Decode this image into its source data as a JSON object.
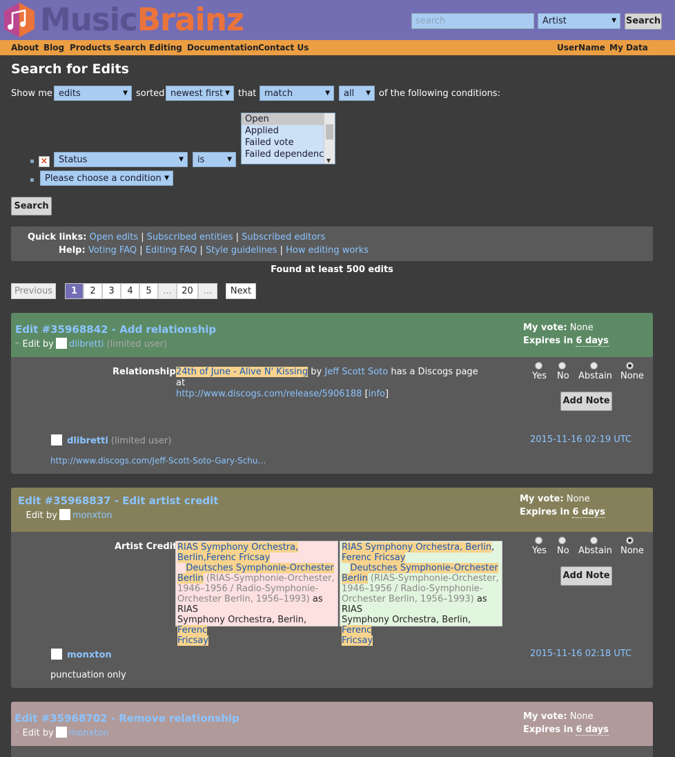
{
  "header": {
    "logo_text_1": "Music",
    "logo_text_2": "Brainz",
    "search_placeholder": "search",
    "search_type": "Artist",
    "search_button": "Search"
  },
  "nav": {
    "left": [
      "About",
      "Blog",
      "Products",
      "Search",
      "Editing",
      "Documentation",
      "Contact Us"
    ],
    "right": [
      "UserName",
      "My Data"
    ]
  },
  "form": {
    "title": "Search for Edits",
    "show_me_label": "Show me",
    "show_me_value": "edits",
    "sorted_label": "sorted",
    "sorted_value": "newest first",
    "that_label": "that",
    "match_value": "match",
    "all_value": "all",
    "conditions_label": "of the following conditions:",
    "condition_field": "Status",
    "condition_op": "is",
    "status_options": [
      "Open",
      "Applied",
      "Failed vote",
      "Failed dependency"
    ],
    "new_condition": "Please choose a condition",
    "search_button": "Search"
  },
  "quicklinks": {
    "label": "Quick links:",
    "links": [
      "Open edits",
      "Subscribed entities",
      "Subscribed editors"
    ],
    "help_label": "Help:",
    "help_links": [
      "Voting FAQ",
      "Editing FAQ",
      "Style guidelines",
      "How editing works"
    ]
  },
  "found": "Found at least 500 edits",
  "pagination": {
    "previous": "Previous",
    "pages": [
      "1",
      "2",
      "3",
      "4",
      "5",
      "…",
      "20",
      "…"
    ],
    "current": "1",
    "next": "Next"
  },
  "vote_options": [
    "Yes",
    "No",
    "Abstain",
    "None"
  ],
  "edits": [
    {
      "title": "Edit #35968842 - Add relationship",
      "edit_by": "Edit by",
      "editor": "dlibretti",
      "editor_note": "(limited user)",
      "my_vote_label": "My vote:",
      "my_vote": "None",
      "expires_label": "Expires in",
      "expires": "6 days",
      "field_label": "Relationship:",
      "rel_release": "24th of June - Alive N' Kissing",
      "rel_by": "by",
      "rel_artist": "Jeff Scott Soto",
      "rel_text": "has a Discogs page at",
      "rel_url": "http://www.discogs.com/release/5906188",
      "rel_info": "info",
      "add_note": "Add Note",
      "note_editor": "dlibretti",
      "note_editor_note": "(limited user)",
      "note_date": "2015-11-16 02:19 UTC",
      "note_text": "http://www.discogs.com/Jeff-Scott-Soto-Gary-Schu…"
    },
    {
      "title": "Edit #35968837 - Edit artist credit",
      "edit_by": "Edit by",
      "editor": "monxton",
      "my_vote_label": "My vote:",
      "my_vote": "None",
      "expires_label": "Expires in",
      "expires": "6 days",
      "field_label": "Artist Credit:",
      "old_l1": "RIAS Symphony Orchestra,",
      "old_l2": "Berlin,Ferenc Fricsay",
      "old_l3": "Deutsches Symphonie-Orchester",
      "old_l4": "Berlin",
      "old_l4b": "(RIAS-Symphonie-Orchester,",
      "old_l5": "1946–1956 / Radio-Symphonie-",
      "old_l6": "Orchester Berlin, 1956–1993)",
      "old_l6b": "as RIAS",
      "old_l7": "Symphony Orchestra, Berlin,",
      "old_l7b": "Ferenc",
      "old_l8": "Fricsay",
      "new_l1": "RIAS Symphony Orchestra, Berlin",
      "new_l1b": ",",
      "new_l2": "Ferenc Fricsay",
      "new_l3": "Deutsches Symphonie-Orchester",
      "new_l4": "Berlin",
      "new_l4b": "(RIAS-Symphonie-Orchester,",
      "new_l5": "1946–1956 / Radio-Symphonie-",
      "new_l6": "Orchester Berlin, 1956–1993)",
      "new_l6b": "as RIAS",
      "new_l7": "Symphony Orchestra, Berlin,",
      "new_l7b": "Ferenc",
      "new_l8": "Fricsay",
      "add_note": "Add Note",
      "note_editor": "monxton",
      "note_date": "2015-11-16 02:18 UTC",
      "note_text": "punctuation only"
    },
    {
      "title": "Edit #35968702 - Remove relationship",
      "edit_by": "Edit by",
      "editor": "monxton",
      "my_vote_label": "My vote:",
      "my_vote": "None",
      "expires_label": "Expires in",
      "expires": "6 days"
    }
  ]
}
